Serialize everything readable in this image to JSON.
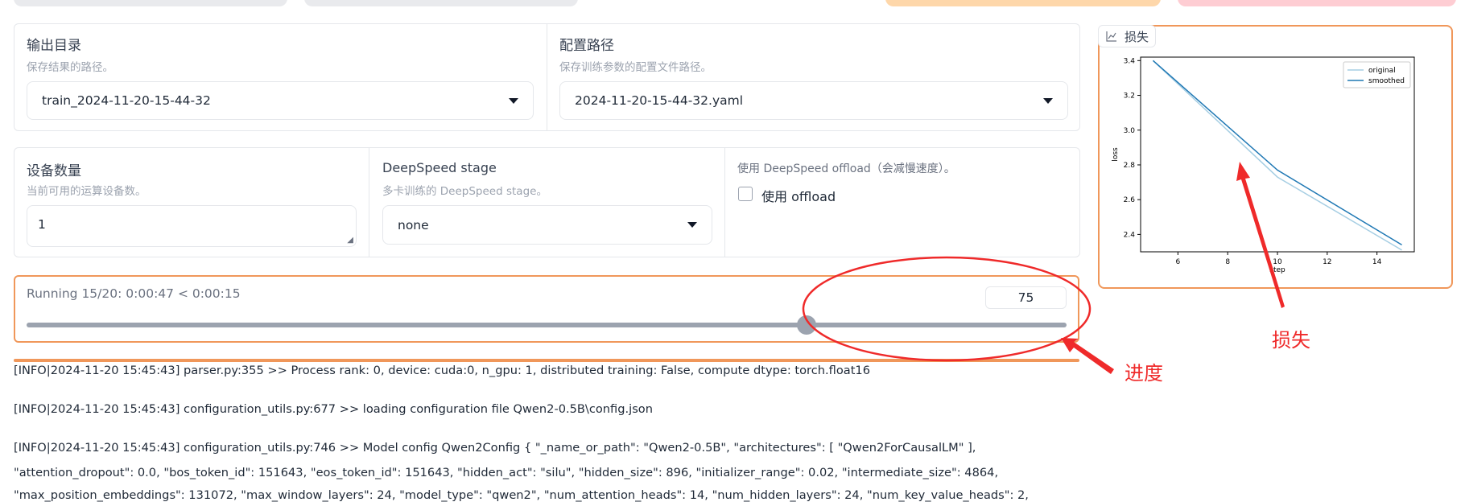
{
  "output_dir": {
    "label": "输出目录",
    "hint": "保存结果的路径。",
    "value": "train_2024-11-20-15-44-32"
  },
  "config_path": {
    "label": "配置路径",
    "hint": "保存训练参数的配置文件路径。",
    "value": "2024-11-20-15-44-32.yaml"
  },
  "device_count": {
    "label": "设备数量",
    "hint": "当前可用的运算设备数。",
    "value": "1"
  },
  "deepspeed_stage": {
    "label": "DeepSpeed stage",
    "hint": "多卡训练的 DeepSpeed stage。",
    "value": "none"
  },
  "deepspeed_offload": {
    "label": "使用 DeepSpeed offload（会减慢速度）。",
    "checkbox_label": "使用 offload",
    "checked": false
  },
  "progress": {
    "status": "Running 15/20: 0:00:47 < 0:00:15",
    "value": "75",
    "fraction": 0.75
  },
  "loss_panel": {
    "tab_label": "损失"
  },
  "chart_data": {
    "type": "line",
    "xlabel": "step",
    "ylabel": "loss",
    "xlim": [
      4.5,
      15.5
    ],
    "ylim": [
      2.3,
      3.42
    ],
    "x_ticks": [
      "6",
      "8",
      "10",
      "12",
      "14"
    ],
    "y_ticks": [
      "2.4",
      "2.6",
      "2.8",
      "3.0",
      "3.2",
      "3.4"
    ],
    "legend_position": "top-right",
    "series": [
      {
        "name": "original",
        "color": "#a6cee3",
        "x": [
          5,
          10,
          15
        ],
        "y": [
          3.4,
          2.73,
          2.31
        ]
      },
      {
        "name": "smoothed",
        "color": "#1f78b4",
        "x": [
          5,
          10,
          15
        ],
        "y": [
          3.4,
          2.77,
          2.34
        ]
      }
    ]
  },
  "logs": [
    "[INFO|2024-11-20 15:45:43] parser.py:355 >> Process rank: 0, device: cuda:0, n_gpu: 1, distributed training: False, compute dtype: torch.float16",
    "[INFO|2024-11-20 15:45:43] configuration_utils.py:677 >> loading configuration file Qwen2-0.5B\\config.json",
    "[INFO|2024-11-20 15:45:43] configuration_utils.py:746 >> Model config Qwen2Config { \"_name_or_path\": \"Qwen2-0.5B\", \"architectures\": [ \"Qwen2ForCausalLM\" ],",
    "\"attention_dropout\": 0.0, \"bos_token_id\": 151643, \"eos_token_id\": 151643, \"hidden_act\": \"silu\", \"hidden_size\": 896, \"initializer_range\": 0.02, \"intermediate_size\": 4864,",
    "\"max_position_embeddings\": 131072, \"max_window_layers\": 24, \"model_type\": \"qwen2\", \"num_attention_heads\": 14, \"num_hidden_layers\": 24, \"num_key_value_heads\": 2,"
  ],
  "annotations": {
    "progress_note": "进度",
    "loss_note": "损失"
  },
  "colors": {
    "accent_orange": "#f0975a",
    "annotation_red": "#ef2a2a"
  }
}
